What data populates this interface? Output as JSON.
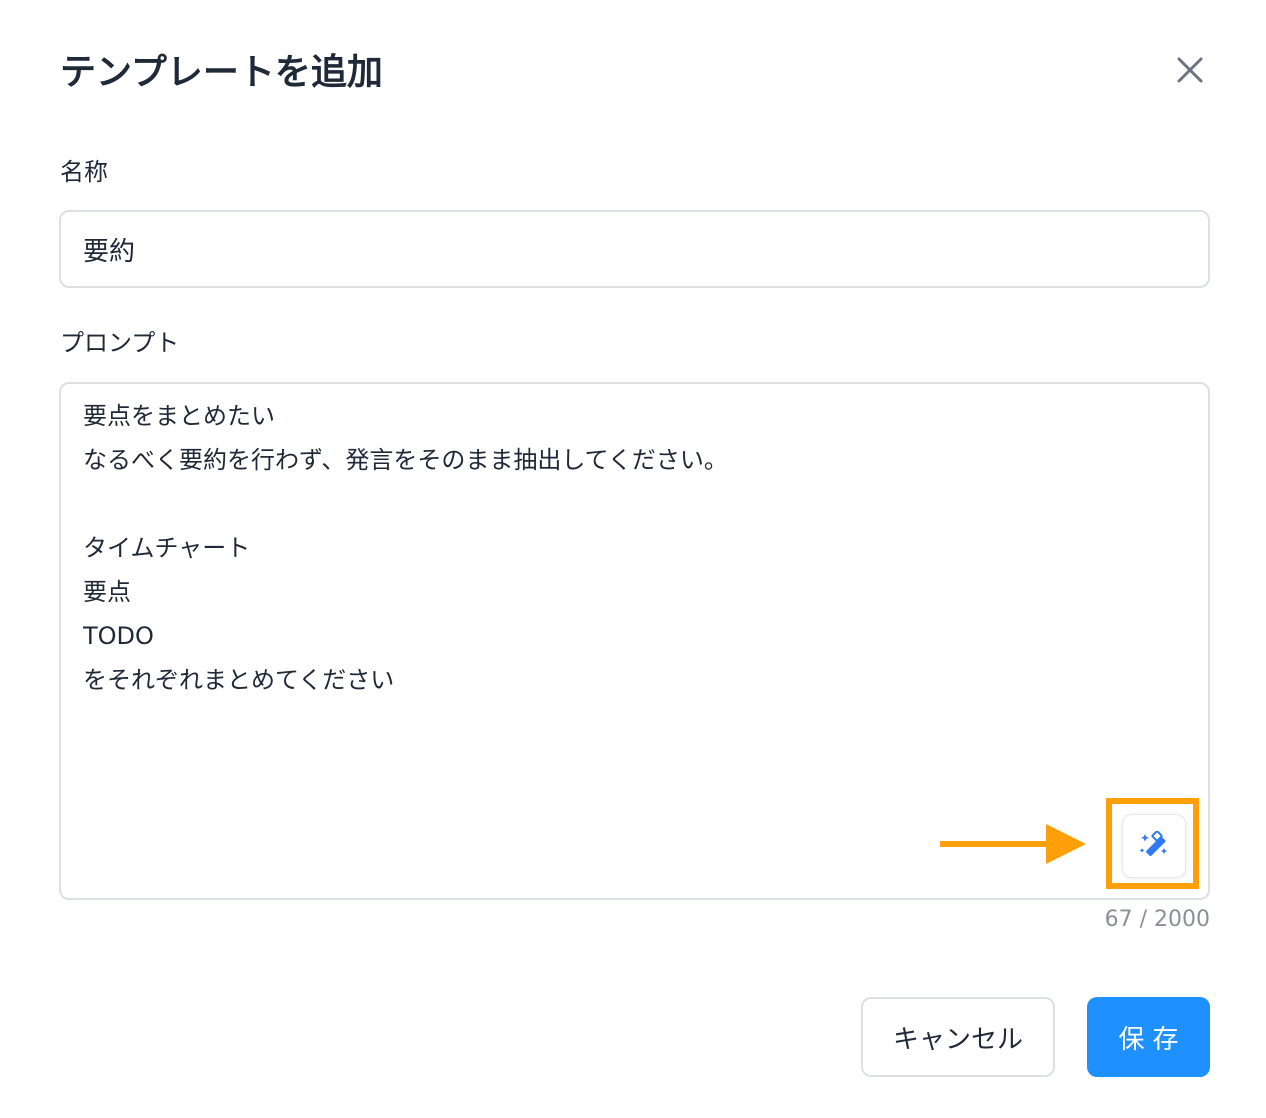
{
  "dialog": {
    "title": "テンプレートを追加",
    "close_icon": "close-icon"
  },
  "name_field": {
    "label": "名称",
    "value": "要約"
  },
  "prompt_field": {
    "label": "プロンプト",
    "value": "要点をまとめたい\nなるべく要約を行わず、発言をそのまま抽出してください。\n\nタイムチャート\n要点\nTODO\nをそれぞれまとめてください",
    "counter": "67 / 2000",
    "magic_icon": "magic-wand-icon"
  },
  "annotation": {
    "arrow_icon": "arrow-right-icon",
    "highlight_color": "#ff9f0a"
  },
  "actions": {
    "cancel_label": "キャンセル",
    "save_label": "保存"
  },
  "colors": {
    "primary": "#1e90ff",
    "border": "#dcdfe4",
    "muted_text": "#8a8f98"
  }
}
